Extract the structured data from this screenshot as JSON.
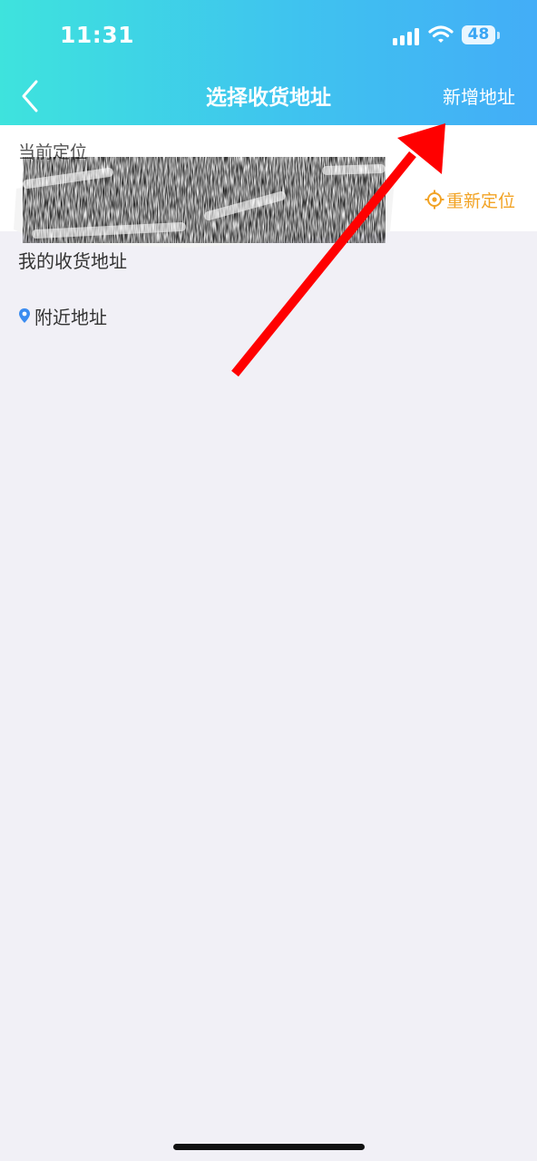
{
  "status_bar": {
    "time": "11:31",
    "battery": "48",
    "icons": [
      "cellular-signal-icon",
      "wifi-icon",
      "battery-icon"
    ]
  },
  "header": {
    "title": "选择收货地址",
    "back_icon": "chevron-left-icon",
    "add_label": "新增地址",
    "gradient": [
      "#3ee3dd",
      "#43adf7"
    ]
  },
  "current_location": {
    "label": "当前定位",
    "address": "",
    "relocate_label": "重新定位",
    "relocate_color": "#f2a324"
  },
  "my_addresses": {
    "title": "我的收货地址"
  },
  "nearby": {
    "label": "附近地址",
    "icon": "location-pin-icon"
  },
  "annotation": {
    "type": "red-arrow",
    "color": "#ff0000",
    "points_to": "add-address-button"
  }
}
